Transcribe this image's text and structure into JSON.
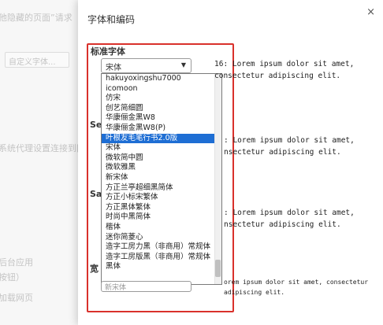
{
  "background": {
    "line1": "他隐藏的页面”请求",
    "button": "自定义字体...",
    "line2": "系统代理设置连接到网",
    "line3": "后台应用",
    "line4": "按钮）",
    "line5": "加载网页"
  },
  "dialog": {
    "title": "字体和编码",
    "close_glyph": "×",
    "standard_label": "标准字体",
    "serif_label": "Se",
    "sans_label": "Sa",
    "fixed_label": "宽",
    "select_value": "宋体",
    "select2_value": "新宋体",
    "dropdown_items": [
      "hakuyoxingshu7000",
      "icomoon",
      "仿宋",
      "创艺简细圆",
      "华康俪金黑W8",
      "华康俪金黑W8(P)",
      "叶根友毛笔行书2.0版",
      "宋体",
      "微软简中圆",
      "微软雅黑",
      "新宋体",
      "方正兰亭超细黑简体",
      "方正小标宋繁体",
      "方正黑体繁体",
      "时尚中黑简体",
      "楷体",
      "迷你简菱心",
      "造字工房力黑（非商用）常规体",
      "造字工房版黑（非商用）常规体",
      "黑体"
    ],
    "selected_index": 6,
    "preview1_line1": "16: Lorem ipsum dolor sit amet,",
    "preview1_line2": "consectetur adipiscing elit.",
    "preview2_line1": ": Lorem ipsum dolor sit amet,",
    "preview2_line2": "nsectetur adipiscing elit.",
    "preview3_line1": ": Lorem ipsum dolor sit amet,",
    "preview3_line2": "nsectetur adipiscing elit.",
    "preview4_line1": "orem ipsum dolor sit amet, consectetur",
    "preview4_line2": "adipiscing elit."
  },
  "colors": {
    "highlight_border": "#d9312b",
    "selected_item": "#1e6ed4"
  }
}
